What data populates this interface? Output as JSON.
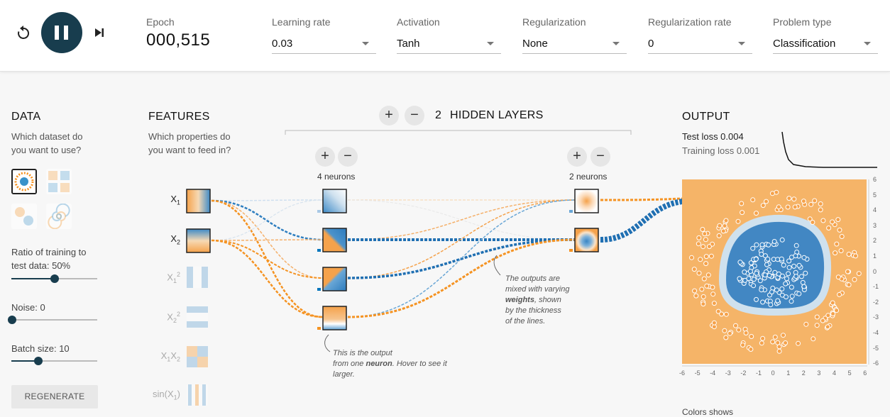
{
  "controls": {
    "reset_icon": "reset-icon",
    "pause_icon": "pause-icon",
    "step_icon": "step-forward-icon"
  },
  "epoch": {
    "label": "Epoch",
    "value": "000,515"
  },
  "settings": [
    {
      "label": "Learning rate",
      "value": "0.03"
    },
    {
      "label": "Activation",
      "value": "Tanh"
    },
    {
      "label": "Regularization",
      "value": "None"
    },
    {
      "label": "Regularization rate",
      "value": "0"
    },
    {
      "label": "Problem type",
      "value": "Classification"
    }
  ],
  "data_panel": {
    "title": "DATA",
    "subtitle_line1": "Which dataset do",
    "subtitle_line2": "you want to use?",
    "datasets": [
      "circle",
      "xor",
      "gaussian",
      "spiral"
    ],
    "selected_dataset": "circle",
    "ratio_label_line1": "Ratio of training to",
    "ratio_label_line2": "test data:  50%",
    "ratio_value": 50,
    "noise_label": "Noise:  0",
    "noise_value": 0,
    "batch_label": "Batch size:  10",
    "batch_value": 10,
    "regenerate_label": "REGENERATE"
  },
  "features_panel": {
    "title": "FEATURES",
    "subtitle_line1": "Which properties do",
    "subtitle_line2": "you want to feed in?",
    "features": [
      {
        "base": "X",
        "sub": "1",
        "sup": "",
        "active": true
      },
      {
        "base": "X",
        "sub": "2",
        "sup": "",
        "active": true
      },
      {
        "base": "X",
        "sub": "1",
        "sup": "2",
        "active": false
      },
      {
        "base": "X",
        "sub": "2",
        "sup": "2",
        "active": false
      },
      {
        "base": "X",
        "sub": "1",
        "base2": "X",
        "sub2": "2",
        "active": false
      },
      {
        "base": "sin(X",
        "sub": "1",
        "tail": ")",
        "active": false
      }
    ]
  },
  "hidden": {
    "plus": "+",
    "minus": "−",
    "count": "2",
    "label": "HIDDEN LAYERS",
    "layer1_neurons": "4 neurons",
    "layer2_neurons": "2 neurons"
  },
  "annotations": {
    "neuron_note": [
      "This is the output",
      "from one ",
      "neuron",
      ". Hover to see it",
      "larger."
    ],
    "weights_note": [
      "The outputs are",
      "mixed with varying",
      "weights",
      ", shown",
      "by the thickness",
      "of the lines."
    ]
  },
  "output_panel": {
    "title": "OUTPUT",
    "test_loss": "Test loss 0.004",
    "train_loss": "Training loss 0.001",
    "y_ticks": [
      "6",
      "5",
      "4",
      "3",
      "2",
      "1",
      "0",
      "-1",
      "-2",
      "-3",
      "-4",
      "-5",
      "-6"
    ],
    "x_ticks": [
      "-6",
      "-5",
      "-4",
      "-3",
      "-2",
      "-1",
      "0",
      "1",
      "2",
      "3",
      "4",
      "5",
      "6"
    ],
    "bottom_note": "Colors shows"
  },
  "colors": {
    "orange": "#f59322",
    "blue": "#0877bd",
    "dark": "#183d4e"
  }
}
